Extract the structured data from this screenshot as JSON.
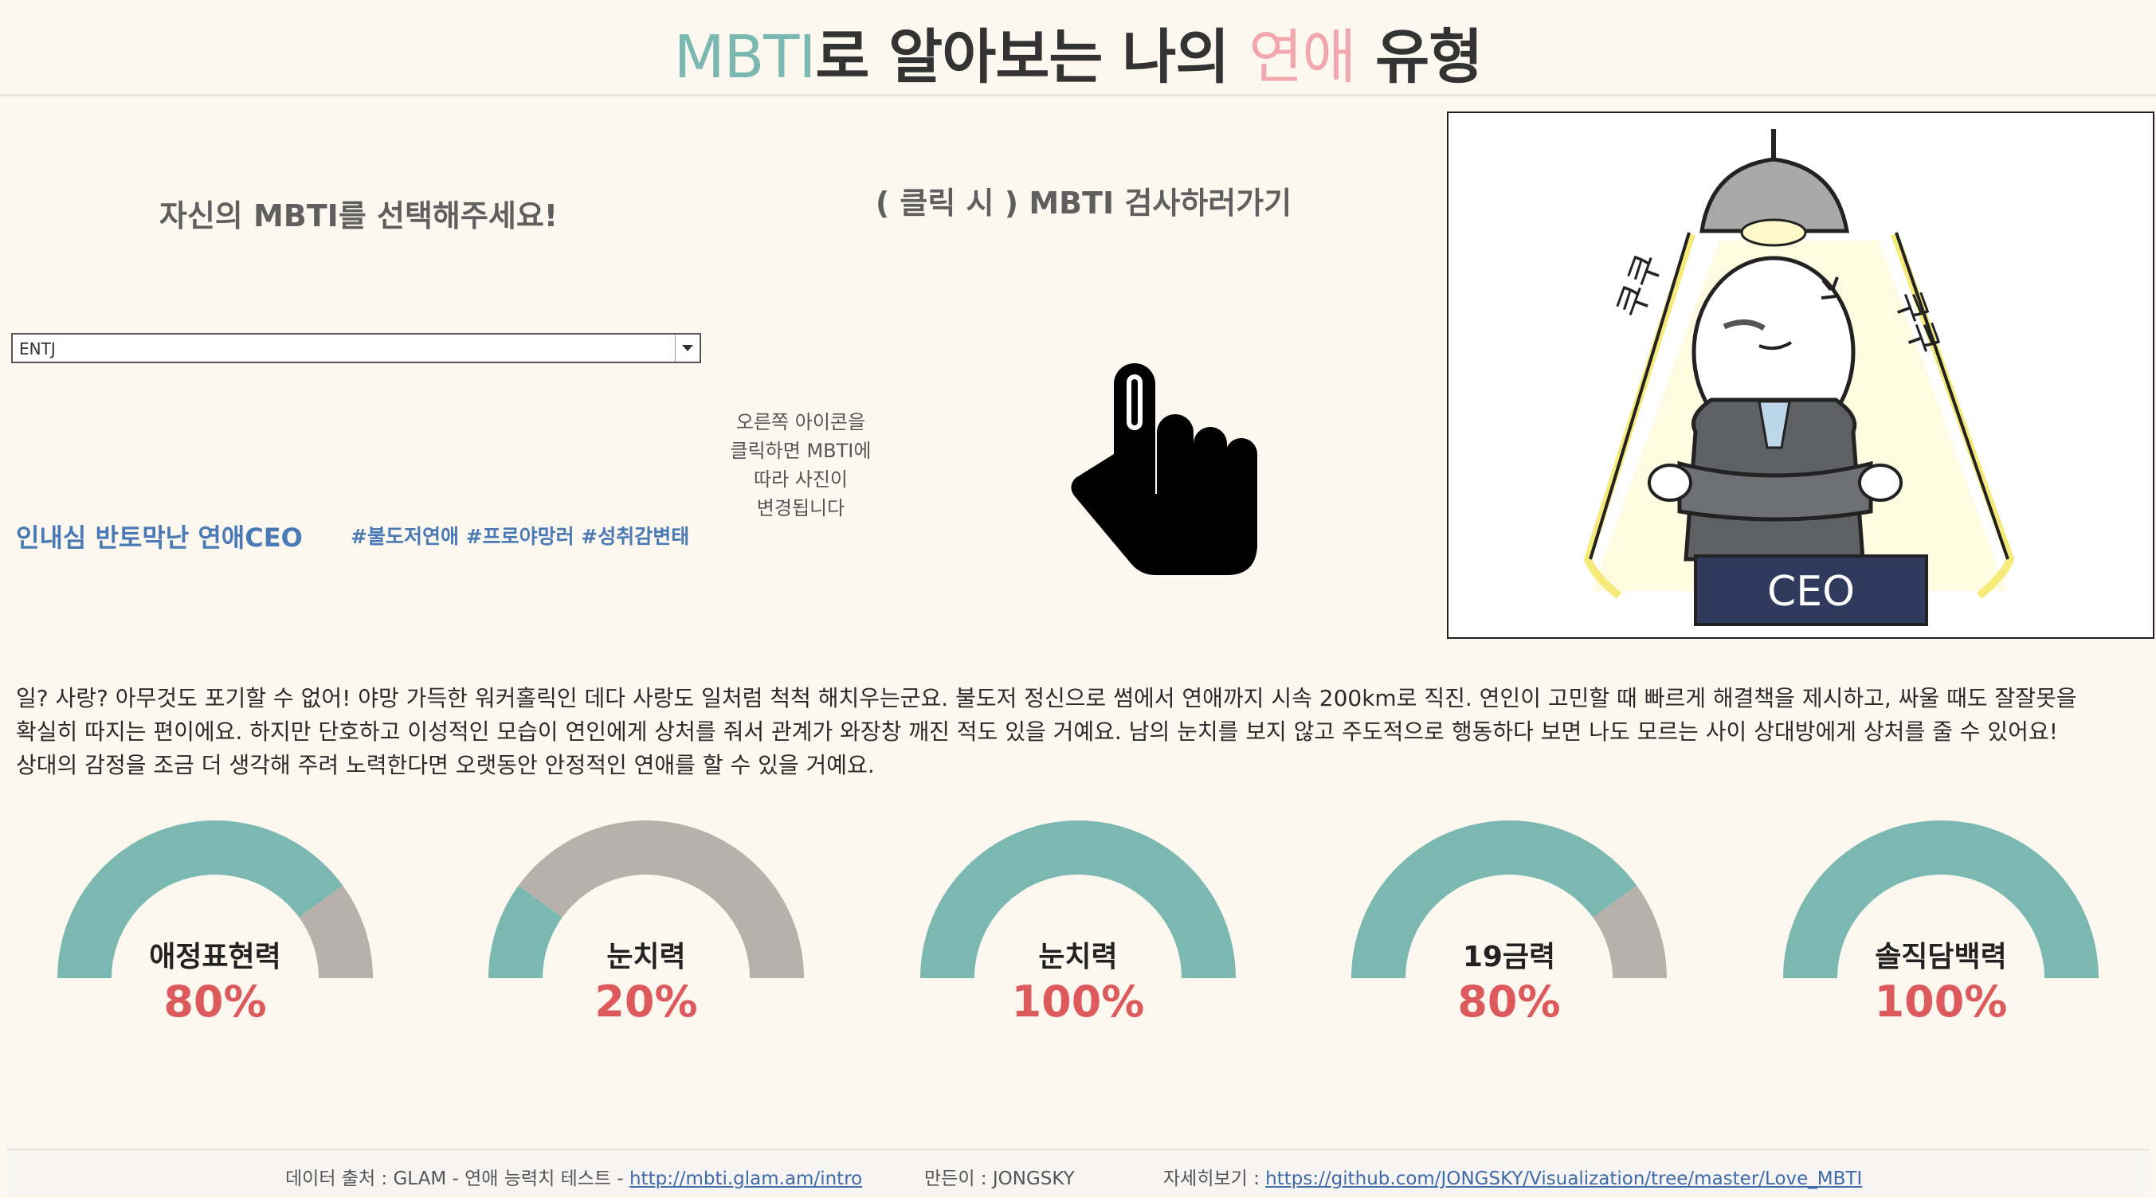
{
  "header": {
    "title_part1": "MBTI",
    "title_part2": "로 알아보는 나의 ",
    "title_part3": "연애",
    "title_part4": " 유형",
    "accent_teal": "#7ab8b1",
    "accent_pink": "#f2a6ae"
  },
  "selector": {
    "label": "자신의 MBTI를 선택해주세요!",
    "value": "ENTJ",
    "icon": "chevron-down-icon"
  },
  "test_link": {
    "label": "( 클릭 시 ) MBTI 검사하러가기"
  },
  "hint": {
    "line1": "오른쪽 아이콘을",
    "line2": "클릭하면 MBTI에",
    "line3": "따라 사진이",
    "line4": "변경됩니다",
    "icon": "pointer-hand-icon"
  },
  "result": {
    "type_name": "인내심 반토막난 연애CEO",
    "tags": "#불도저연애 #프로야망러 #성취감변태",
    "badge_text": "CEO",
    "bubble_left": "쿠쿠",
    "bubble_right": "쿠쿠"
  },
  "description": {
    "line1": "일? 사랑? 아무것도 포기할 수 없어! 야망 가득한 워커홀릭인 데다 사랑도 일처럼 척척 해치우는군요. 불도저 정신으로 썸에서 연애까지 시속 200km로 직진. 연인이 고민할 때 빠르게 해결책을 제시하고, 싸울 때도 잘잘못을",
    "line2": "확실히 따지는 편이에요. 하지만 단호하고 이성적인 모습이 연인에게 상처를 줘서 관계가 와장창 깨진 적도 있을 거예요. 남의 눈치를 보지 않고 주도적으로 행동하다 보면 나도 모르는 사이 상대방에게 상처를 줄 수 있어요!",
    "line3": "상대의 감정을 조금 더 생각해 주려 노력한다면 오랫동안 안정적인 연애를 할 수 있을 거예요."
  },
  "gauges": [
    {
      "label": "애정표현력",
      "value_text": "80%",
      "value": 0.8
    },
    {
      "label": "눈치력",
      "value_text": "20%",
      "value": 0.2
    },
    {
      "label": "눈치력",
      "value_text": "100%",
      "value": 1.0
    },
    {
      "label": "19금력",
      "value_text": "80%",
      "value": 0.8
    },
    {
      "label": "솔직담백력",
      "value_text": "100%",
      "value": 1.0
    }
  ],
  "gauge_colors": {
    "filled": "#7ab8b1",
    "empty": "#b8b0aa",
    "value_text": "#dd5a5c"
  },
  "footer": {
    "source_label": "데이터 출처 : GLAM - 연애 능력치 테스트 - ",
    "source_link": "http://mbti.glam.am/intro",
    "author": "만든이 : JONGSKY",
    "more_label": "자세히보기 : ",
    "more_link": "https://github.com/JONGSKY/Visualization/tree/master/Love_MBTI"
  }
}
